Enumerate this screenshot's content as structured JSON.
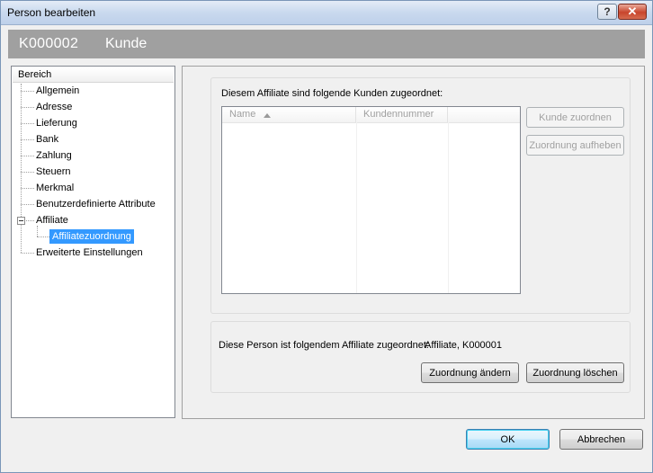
{
  "window": {
    "title": "Person bearbeiten",
    "help_glyph": "?",
    "close_glyph": "✕"
  },
  "header": {
    "code": "K000002",
    "type": "Kunde"
  },
  "tree": {
    "header": "Bereich",
    "items": [
      {
        "label": "Allgemein"
      },
      {
        "label": "Adresse"
      },
      {
        "label": "Lieferung"
      },
      {
        "label": "Bank"
      },
      {
        "label": "Zahlung"
      },
      {
        "label": "Steuern"
      },
      {
        "label": "Merkmal"
      },
      {
        "label": "Benutzerdefinierte Attribute"
      },
      {
        "label": "Affiliate"
      },
      {
        "label": "Affiliatezuordnung",
        "selected": true
      },
      {
        "label": "Erweiterte Einstellungen"
      }
    ]
  },
  "customers": {
    "heading": "Diesem Affiliate sind folgende Kunden zugeordnet:",
    "columns": [
      "Name",
      "Kundennummer"
    ],
    "assign_button": "Kunde zuordnen",
    "remove_button": "Zuordnung aufheben"
  },
  "affiliate": {
    "label": "Diese Person ist folgendem Affiliate zugeordnet:",
    "value": "Affiliate, K000001",
    "change_button": "Zuordnung ändern",
    "delete_button": "Zuordnung löschen"
  },
  "footer": {
    "ok_button": "OK",
    "cancel_button": "Abbrechen"
  },
  "colors": {
    "selection": "#3399ff",
    "header_band": "#a0a0a0"
  }
}
